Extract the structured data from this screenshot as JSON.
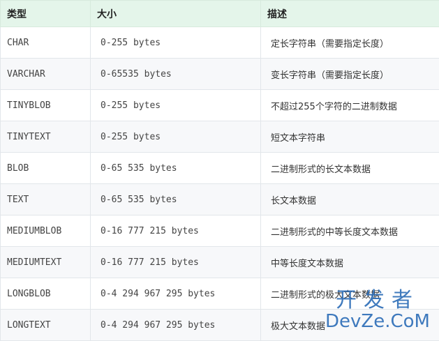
{
  "table": {
    "headers": [
      "类型",
      "大小",
      "描述"
    ],
    "rows": [
      [
        "CHAR",
        "0-255 bytes",
        "定长字符串（需要指定长度）"
      ],
      [
        "VARCHAR",
        "0-65535 bytes",
        "变长字符串（需要指定长度）"
      ],
      [
        "TINYBLOB",
        "0-255 bytes",
        "不超过255个字符的二进制数据"
      ],
      [
        "TINYTEXT",
        "0-255 bytes",
        "短文本字符串"
      ],
      [
        "BLOB",
        "0-65 535 bytes",
        "二进制形式的长文本数据"
      ],
      [
        "TEXT",
        "0-65 535 bytes",
        "长文本数据"
      ],
      [
        "MEDIUMBLOB",
        "0-16 777 215 bytes",
        "二进制形式的中等长度文本数据"
      ],
      [
        "MEDIUMTEXT",
        "0-16 777 215 bytes",
        "中等长度文本数据"
      ],
      [
        "LONGBLOB",
        "0-4 294 967 295 bytes",
        "二进制形式的极大文本数据"
      ],
      [
        "LONGTEXT",
        "0-4 294 967 295 bytes",
        "极大文本数据"
      ]
    ]
  },
  "watermark": {
    "cn": "开发者",
    "en": "DevZe.CoM"
  }
}
